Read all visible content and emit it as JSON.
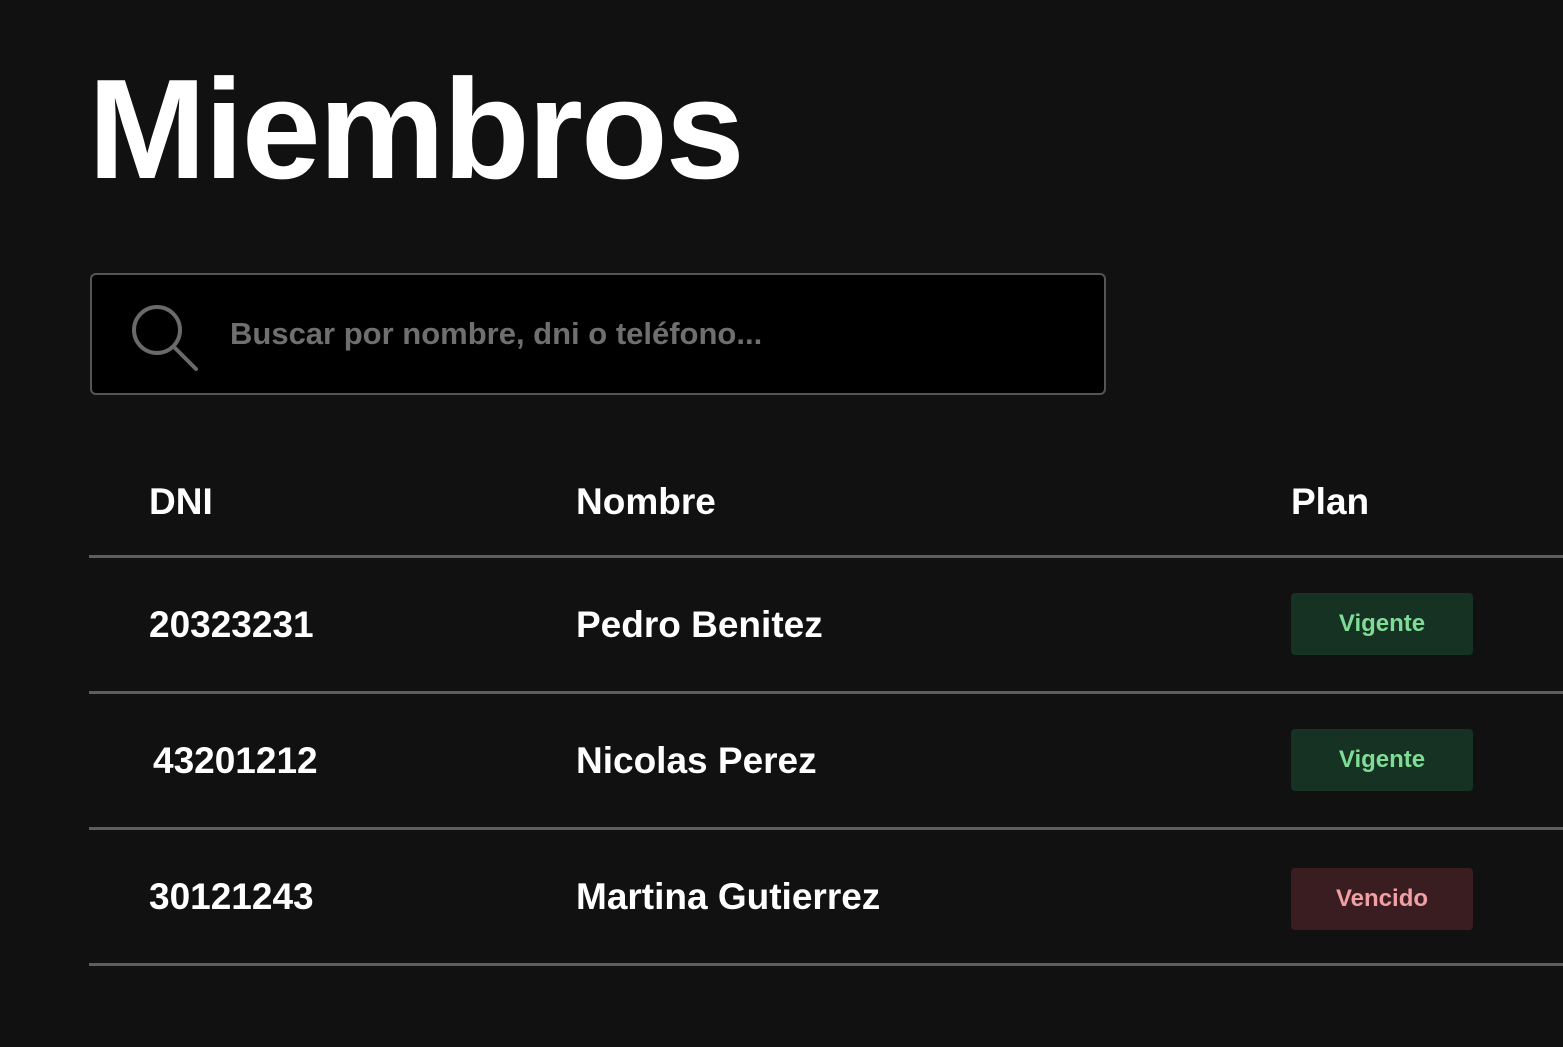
{
  "page": {
    "title": "Miembros"
  },
  "search": {
    "placeholder": "Buscar por nombre, dni o teléfono...",
    "value": ""
  },
  "table": {
    "columns": {
      "dni": "DNI",
      "nombre": "Nombre",
      "plan": "Plan"
    },
    "rows": [
      {
        "dni": "20323231",
        "nombre": "Pedro Benitez",
        "plan": "Vigente",
        "status": "active"
      },
      {
        "dni": "43201212",
        "nombre": "Nicolas Perez",
        "plan": "Vigente",
        "status": "active"
      },
      {
        "dni": "30121243",
        "nombre": "Martina Gutierrez",
        "plan": "Vencido",
        "status": "expired"
      }
    ]
  },
  "colors": {
    "background": "#111111",
    "active_badge_bg": "#163222",
    "active_badge_text": "#7fdc96",
    "expired_badge_bg": "#3a1d20",
    "expired_badge_text": "#f0a0a4"
  },
  "icons": {
    "search": "search-icon"
  }
}
